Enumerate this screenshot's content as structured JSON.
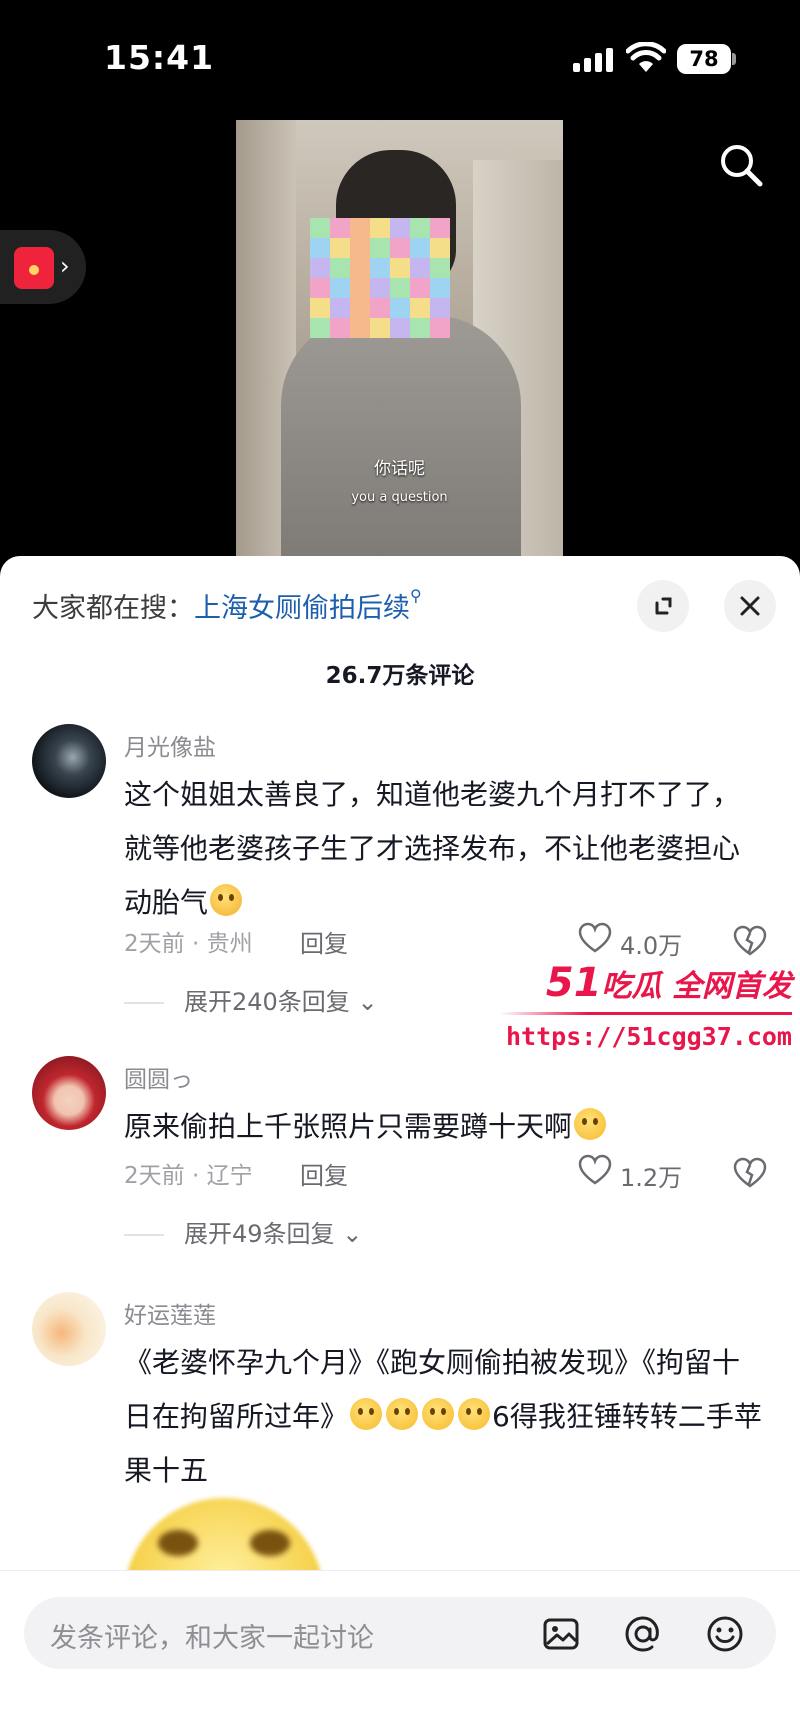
{
  "status_bar": {
    "time": "15:41",
    "battery": "78"
  },
  "video": {
    "subtitle_cn": "你话呢",
    "subtitle_en": "you a question"
  },
  "panel": {
    "search_hint_prefix": "大家都在搜：",
    "search_hint_link": "上海女厕偷拍后续",
    "comment_count": "26.7万条评论"
  },
  "comments": [
    {
      "name": "月光像盐",
      "text": "这个姐姐太善良了，知道他老婆九个月打不了了，就等他老婆孩子生了才选择发布，不让他老婆担心动胎气",
      "emoji": "crying-emoji",
      "meta": "2天前 · 贵州",
      "reply": "回复",
      "likes": "4.0万",
      "expand": "展开240条回复"
    },
    {
      "name": "圆圆っ",
      "text": "原来偷拍上千张照片只需要蹲十天啊",
      "emoji": "smile-emoji",
      "meta": "2天前 · 辽宁",
      "reply": "回复",
      "likes": "1.2万",
      "expand": "展开49条回复"
    },
    {
      "name": "好运莲莲",
      "text_part1": "《老婆怀孕九个月》《跑女厕偷拍被发现》《拘留十日在拘留所过年》",
      "text_part2": "6得我狂锤转转二手苹果十五",
      "emoji": "laughing-emoji"
    }
  ],
  "watermark": {
    "brand_num": "51",
    "brand_text": "吃瓜 全网首发",
    "url": "https://51cgg37.com"
  },
  "input_bar": {
    "placeholder": "发条评论，和大家一起讨论"
  },
  "colors": {
    "link": "#1d5fae",
    "watermark": "#e8164b",
    "panel_bg": "#ffffff",
    "screen_bg": "#000000"
  }
}
